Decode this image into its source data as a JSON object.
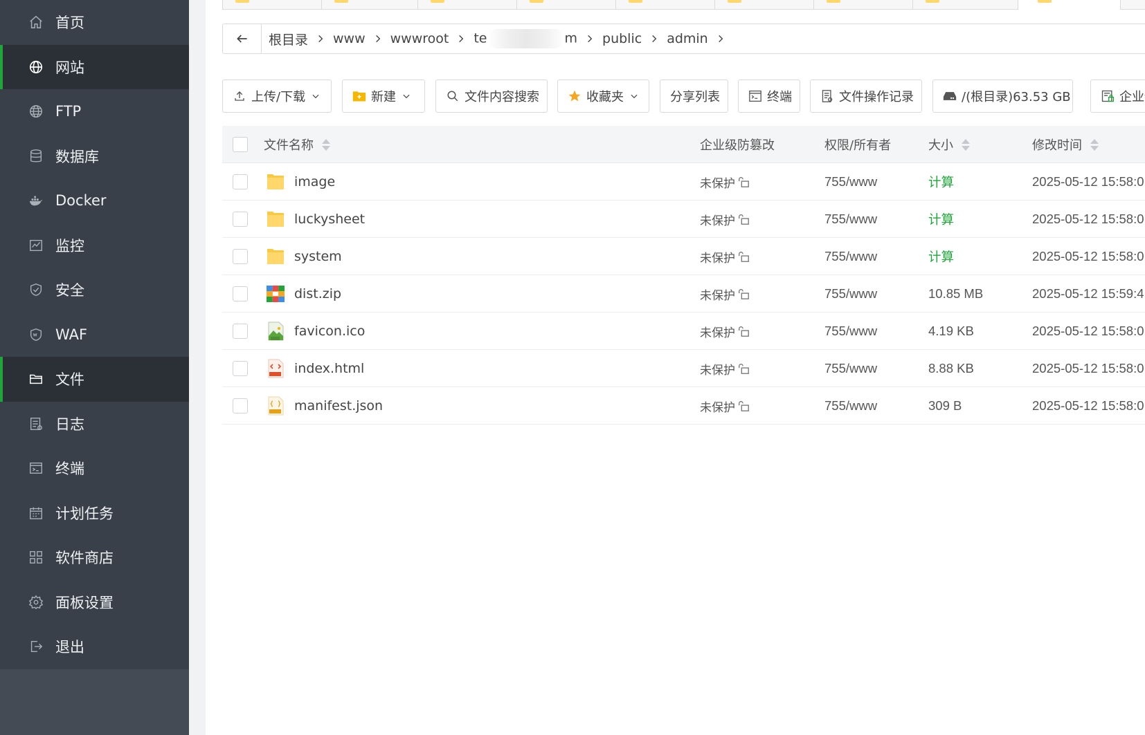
{
  "sidebar": {
    "items": [
      {
        "label": "首页",
        "icon": "home-icon",
        "active": false
      },
      {
        "label": "网站",
        "icon": "globe-icon",
        "active": true
      },
      {
        "label": "FTP",
        "icon": "ftp-globe-icon",
        "active": false
      },
      {
        "label": "数据库",
        "icon": "database-icon",
        "active": false
      },
      {
        "label": "Docker",
        "icon": "docker-icon",
        "active": false
      },
      {
        "label": "监控",
        "icon": "monitor-icon",
        "active": false
      },
      {
        "label": "安全",
        "icon": "shield-check-icon",
        "active": false
      },
      {
        "label": "WAF",
        "icon": "waf-shield-icon",
        "active": false
      },
      {
        "label": "文件",
        "icon": "folder-icon",
        "active": true
      },
      {
        "label": "日志",
        "icon": "log-icon",
        "active": false
      },
      {
        "label": "终端",
        "icon": "terminal-icon",
        "active": false
      },
      {
        "label": "计划任务",
        "icon": "calendar-icon",
        "active": false
      },
      {
        "label": "软件商店",
        "icon": "grid-icon",
        "active": false
      },
      {
        "label": "面板设置",
        "icon": "gear-icon",
        "active": false
      },
      {
        "label": "退出",
        "icon": "logout-icon",
        "active": false
      }
    ]
  },
  "breadcrumb": {
    "items": [
      "根目录",
      "www",
      "wwwroot",
      "te",
      "m",
      "public",
      "admin"
    ]
  },
  "toolbar": {
    "upload": "上传/下载",
    "new": "新建",
    "search": "文件内容搜索",
    "favorites": "收藏夹",
    "share_list": "分享列表",
    "terminal": "终端",
    "op_log": "文件操作记录",
    "disk": "/(根目录)63.53 GB",
    "enterprise": "企业级"
  },
  "table": {
    "headers": {
      "name": "文件名称",
      "protect": "企业级防篡改",
      "perm": "权限/所有者",
      "size": "大小",
      "mtime": "修改时间"
    },
    "rows": [
      {
        "name": "image",
        "type": "folder",
        "protect": "未保护",
        "perm": "755/www",
        "size": "计算",
        "size_is_calc": true,
        "mtime": "2025-05-12 15:58:0"
      },
      {
        "name": "luckysheet",
        "type": "folder",
        "protect": "未保护",
        "perm": "755/www",
        "size": "计算",
        "size_is_calc": true,
        "mtime": "2025-05-12 15:58:0"
      },
      {
        "name": "system",
        "type": "folder",
        "protect": "未保护",
        "perm": "755/www",
        "size": "计算",
        "size_is_calc": true,
        "mtime": "2025-05-12 15:58:0"
      },
      {
        "name": "dist.zip",
        "type": "zip",
        "protect": "未保护",
        "perm": "755/www",
        "size": "10.85 MB",
        "size_is_calc": false,
        "mtime": "2025-05-12 15:59:4"
      },
      {
        "name": "favicon.ico",
        "type": "ico",
        "protect": "未保护",
        "perm": "755/www",
        "size": "4.19 KB",
        "size_is_calc": false,
        "mtime": "2025-05-12 15:58:0"
      },
      {
        "name": "index.html",
        "type": "html",
        "protect": "未保护",
        "perm": "755/www",
        "size": "8.88 KB",
        "size_is_calc": false,
        "mtime": "2025-05-12 15:58:0"
      },
      {
        "name": "manifest.json",
        "type": "json",
        "protect": "未保护",
        "perm": "755/www",
        "size": "309 B",
        "size_is_calc": false,
        "mtime": "2025-05-12 15:58:0"
      }
    ]
  },
  "colors": {
    "sidebar_bg": "#39404a",
    "sidebar_active": "#2b3037",
    "accent_green": "#20a53a",
    "folder_yellow": "#ffd76b"
  }
}
